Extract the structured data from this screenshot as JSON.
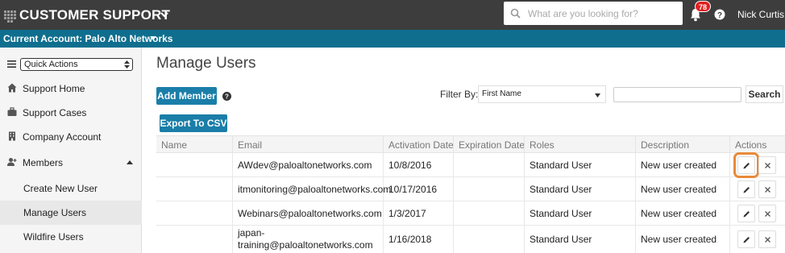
{
  "header": {
    "brand": "CUSTOMER SUPPORT",
    "search_placeholder": "What are you looking for?",
    "notification_count": "78",
    "user_name": "Nick Curtis"
  },
  "account_bar": {
    "label": "Current Account: Palo Alto Networks"
  },
  "sidebar": {
    "quick_actions": "Quick Actions",
    "items": [
      {
        "label": "Support Home",
        "icon": "home-icon"
      },
      {
        "label": "Support Cases",
        "icon": "briefcase-icon"
      },
      {
        "label": "Company Account",
        "icon": "building-icon"
      },
      {
        "label": "Members",
        "icon": "add-user-icon"
      }
    ],
    "sub_items": [
      {
        "label": "Create New User"
      },
      {
        "label": "Manage Users"
      },
      {
        "label": "Wildfire Users"
      }
    ]
  },
  "main": {
    "title": "Manage Users",
    "add_member_label": "Add Member",
    "export_label": "Export To CSV",
    "filter_label": "Filter By:",
    "filter_value": "First Name",
    "search_button": "Search",
    "columns": [
      "Name",
      "Email",
      "Activation Date",
      "Expiration Date",
      "Roles",
      "Description",
      "Actions"
    ],
    "rows": [
      {
        "name": "",
        "email": "AWdev@paloaltonetworks.com",
        "activation": "10/8/2016",
        "expiration": "",
        "role": "Standard User",
        "description": "New user created"
      },
      {
        "name": "",
        "email": "itmonitoring@paloaltonetworks.com",
        "activation": "10/17/2016",
        "expiration": "",
        "role": "Standard User",
        "description": "New user created"
      },
      {
        "name": "",
        "email": "Webinars@paloaltonetworks.com",
        "activation": "1/3/2017",
        "expiration": "",
        "role": "Standard User",
        "description": "New user created"
      },
      {
        "name": "",
        "email": "japan-training@paloaltonetworks.com",
        "activation": "1/16/2018",
        "expiration": "",
        "role": "Standard User",
        "description": "New user created"
      }
    ]
  },
  "colors": {
    "topbar": "#3d3d3d",
    "accountbar": "#0f6e8e",
    "primary_button": "#1a7ea8",
    "badge": "#e02020",
    "highlight": "#e88a3a"
  }
}
